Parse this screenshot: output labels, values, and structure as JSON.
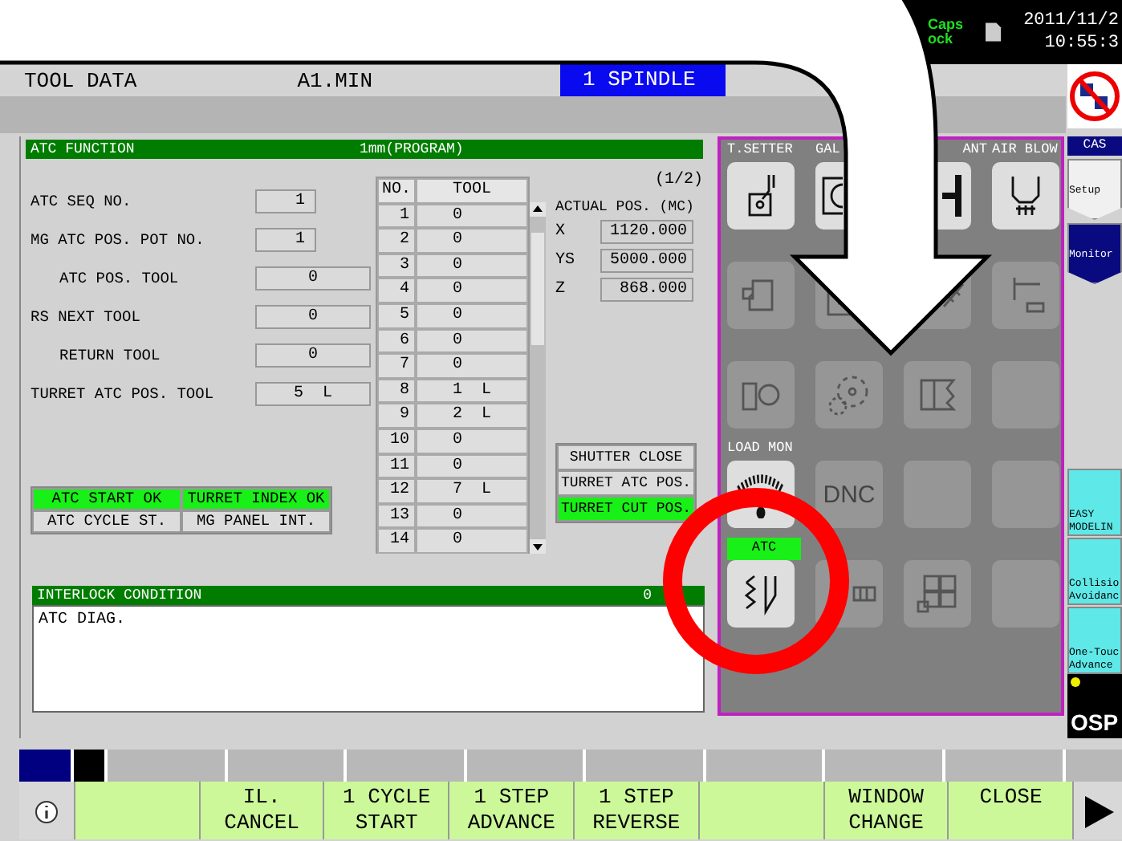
{
  "top_bar": {
    "caps_lock": [
      "Caps",
      "ock"
    ],
    "date": "2011/11/2",
    "time": "10:55:3"
  },
  "header": {
    "title": "TOOL DATA",
    "mode": "A1.MIN",
    "spindle": "1 SPINDLE"
  },
  "atc_function": {
    "title": "ATC FUNCTION",
    "unit": "1mm(PROGRAM)",
    "page": "(1/2)",
    "fields": [
      {
        "label": "ATC SEQ NO.",
        "value": "1",
        "kind": "number"
      },
      {
        "label": "MG ATC POS. POT NO.",
        "value": "1",
        "kind": "number",
        "children": [
          {
            "label": "ATC POS. TOOL",
            "value": "0",
            "kind": "tool"
          }
        ]
      },
      {
        "label": "RS NEXT TOOL",
        "value": "0",
        "kind": "tool",
        "children": [
          {
            "label": "RETURN TOOL",
            "value": "0",
            "kind": "tool"
          }
        ]
      },
      {
        "label": "TURRET ATC POS. TOOL",
        "value": "5  L",
        "kind": "tool"
      }
    ],
    "tool_table": {
      "columns": [
        "NO.",
        "TOOL"
      ],
      "rows": [
        {
          "no": "1",
          "tool": "0"
        },
        {
          "no": "2",
          "tool": "0"
        },
        {
          "no": "3",
          "tool": "0"
        },
        {
          "no": "4",
          "tool": "0"
        },
        {
          "no": "5",
          "tool": "0"
        },
        {
          "no": "6",
          "tool": "0"
        },
        {
          "no": "7",
          "tool": "0"
        },
        {
          "no": "8",
          "tool": "1  L"
        },
        {
          "no": "9",
          "tool": "2  L"
        },
        {
          "no": "10",
          "tool": "0"
        },
        {
          "no": "11",
          "tool": "0"
        },
        {
          "no": "12",
          "tool": "7  L"
        },
        {
          "no": "13",
          "tool": "0"
        },
        {
          "no": "14",
          "tool": "0"
        }
      ]
    },
    "actual_pos": {
      "title": "ACTUAL POS. (MC)",
      "axes": [
        {
          "axis": "X",
          "value": "1120.000"
        },
        {
          "axis": "YS",
          "value": "5000.000"
        },
        {
          "axis": "Z",
          "value": "868.000"
        }
      ]
    },
    "signals": [
      {
        "label": "ATC START OK",
        "on": true
      },
      {
        "label": "TURRET INDEX OK",
        "on": true
      },
      {
        "label": "ATC CYCLE ST.",
        "on": false
      },
      {
        "label": "MG PANEL INT.",
        "on": false
      }
    ],
    "positions": [
      {
        "label": "SHUTTER CLOSE",
        "on": false
      },
      {
        "label": "TURRET ATC POS.",
        "on": false
      },
      {
        "label": "TURRET CUT POS.",
        "on": true
      }
    ],
    "interlock": {
      "title": "INTERLOCK CONDITION",
      "count": "0",
      "lines": [
        "ATC DIAG."
      ]
    }
  },
  "icon_panel": {
    "tiles": [
      {
        "kind": "icon",
        "enabled": true,
        "label": {
          "text": "T.SETTER",
          "highlighted": false
        }
      },
      {
        "kind": "icon",
        "enabled": true,
        "label": {
          "text": "GAL",
          "highlighted": false
        }
      },
      {
        "kind": "icon",
        "enabled": true,
        "label": {
          "text": "ANT",
          "highlighted": false
        }
      },
      {
        "kind": "icon",
        "enabled": true,
        "label": {
          "text": "AIR BLOW",
          "highlighted": false
        }
      },
      {
        "kind": "icon",
        "enabled": false
      },
      {
        "kind": "icon",
        "enabled": false
      },
      {
        "kind": "icon",
        "enabled": false
      },
      {
        "kind": "icon",
        "enabled": false
      },
      {
        "kind": "icon",
        "enabled": false
      },
      {
        "kind": "icon",
        "enabled": false
      },
      {
        "kind": "icon",
        "enabled": false
      },
      {
        "kind": "empty",
        "enabled": false
      },
      {
        "kind": "icon",
        "enabled": true,
        "label": {
          "text": "LOAD MON",
          "highlighted": false
        }
      },
      {
        "kind": "text",
        "enabled": false,
        "text": "DNC"
      },
      {
        "kind": "empty",
        "enabled": false
      },
      {
        "kind": "empty",
        "enabled": false
      },
      {
        "kind": "icon",
        "enabled": true,
        "label": {
          "text": "ATC",
          "highlighted": true
        }
      },
      {
        "kind": "icon",
        "enabled": false
      },
      {
        "kind": "icon",
        "enabled": false
      },
      {
        "kind": "empty",
        "enabled": false
      }
    ]
  },
  "sidebar": {
    "header": "CAS",
    "modes": [
      {
        "label": "Setup",
        "selected": false
      },
      {
        "label": "Monitor",
        "selected": true
      }
    ],
    "apps": [
      {
        "lines": [
          "EASY",
          "MODELIN"
        ]
      },
      {
        "lines": [
          "Collisio",
          "Avoidanc"
        ]
      },
      {
        "lines": [
          "One-Touc",
          "Advance"
        ]
      }
    ],
    "logo": "OSP"
  },
  "function_keys": [
    {
      "kind": "info"
    },
    {
      "kind": "blank"
    },
    {
      "kind": "label",
      "lines": [
        "IL.",
        "CANCEL"
      ]
    },
    {
      "kind": "label",
      "lines": [
        "1 CYCLE",
        "START"
      ]
    },
    {
      "kind": "label",
      "lines": [
        "1 STEP",
        "ADVANCE"
      ]
    },
    {
      "kind": "label",
      "lines": [
        "1 STEP",
        "REVERSE"
      ]
    },
    {
      "kind": "blank"
    },
    {
      "kind": "label",
      "lines": [
        "WINDOW",
        "CHANGE"
      ]
    },
    {
      "kind": "label",
      "lines": [
        "CLOSE"
      ]
    },
    {
      "kind": "next"
    }
  ]
}
